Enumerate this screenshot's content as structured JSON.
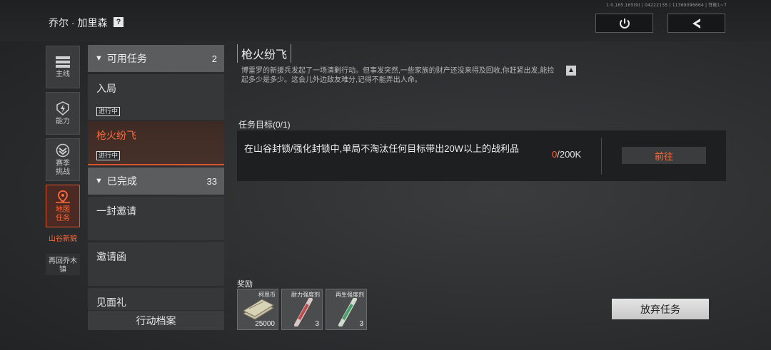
{
  "header": {
    "version": "1.0.165.165(9) | 04222135 | 11369096664 | 性能1~7",
    "player_name": "乔尔 · 加里森",
    "help_icon": "?"
  },
  "rail": {
    "items": [
      {
        "label": "主线",
        "icon": "list-icon"
      },
      {
        "label": "能力",
        "icon": "lightning-shield-icon"
      },
      {
        "label": "赛季\n挑战",
        "icon": "chevron-badge-icon"
      },
      {
        "label": "地图\n任务",
        "icon": "map-pin-icon"
      }
    ],
    "sub_active": "山谷新貌",
    "sub_other": "再回乔木镇"
  },
  "list": {
    "available": {
      "title": "可用任务",
      "count": "2"
    },
    "available_items": [
      {
        "name": "入局",
        "badge": "进行中"
      },
      {
        "name": "枪火纷飞",
        "badge": "进行中"
      }
    ],
    "completed": {
      "title": "已完成",
      "count": "33"
    },
    "completed_items": [
      "一封邀请",
      "邀请函",
      "见面礼"
    ],
    "archive_label": "行动档案"
  },
  "mission": {
    "title": "枪火纷飞",
    "description": "博雷罗的新援兵发起了一场清剿行动。但事发突然,一些家族的财产还没来得及回收,你赶紧出发,能捡起多少是多少。这会儿外边敌友难分,记得不能弄出人命。",
    "objective_label": "任务目标(0/1)",
    "objective_text": "在山谷封锁/强化封锁中,单局不淘汰任何目标带出20W以上的战利品",
    "progress_current": "0",
    "progress_total": "/200K",
    "goto_label": "前往"
  },
  "rewards": {
    "label": "奖励",
    "items": [
      {
        "name": "柯恩币",
        "qty": "25000",
        "icon": "cash-stack-icon"
      },
      {
        "name": "耐力强度剂",
        "qty": "3",
        "icon": "red-syringe-icon"
      },
      {
        "name": "再生强度剂",
        "qty": "3",
        "icon": "green-syringe-icon"
      }
    ]
  },
  "abandon_label": "放弃任务",
  "colors": {
    "accent": "#ff6a3a",
    "panel": "#1d1f20"
  }
}
